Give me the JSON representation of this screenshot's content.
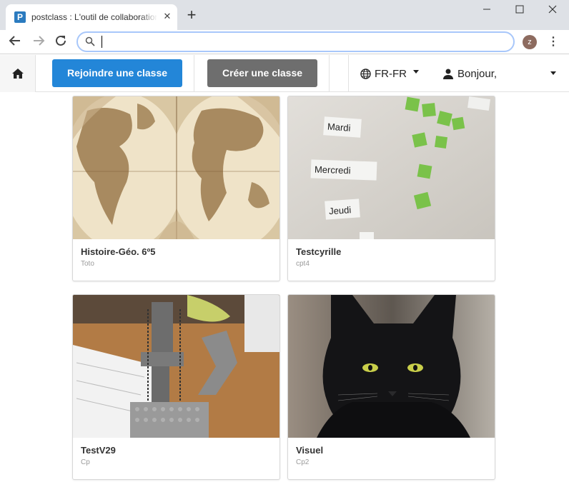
{
  "browser": {
    "tab_title": "postclass : L'outil de collaboration",
    "favicon_letter": "P",
    "tab_close": "✕",
    "new_tab": "+",
    "address_value": "",
    "profile_initial": "z",
    "menu_dots": "⋮",
    "window_minimize": "—",
    "window_maximize": "☐",
    "window_close": "✕"
  },
  "header": {
    "join_label": "Rejoindre une classe",
    "create_label": "Créer une classe",
    "language": "FR-FR",
    "user_greeting": "Bonjour,"
  },
  "classes": [
    {
      "title": "Histoire-Géo. 6º5",
      "subtitle": "Toto",
      "image": "world-map"
    },
    {
      "title": "Testcyrille",
      "subtitle": "cpt4",
      "image": "weekday-cards"
    },
    {
      "title": "TestV29",
      "subtitle": "Cp",
      "image": "lego-robot"
    },
    {
      "title": "Visuel",
      "subtitle": "Cp2",
      "image": "black-cat"
    }
  ],
  "image_text": {
    "mardi": "Mardi",
    "mercredi": "Mercredi",
    "jeudi": "Jeudi"
  },
  "colors": {
    "accent_blue": "#2386d8",
    "button_gray": "#6e6e6e",
    "chrome_bg": "#dee1e6"
  }
}
